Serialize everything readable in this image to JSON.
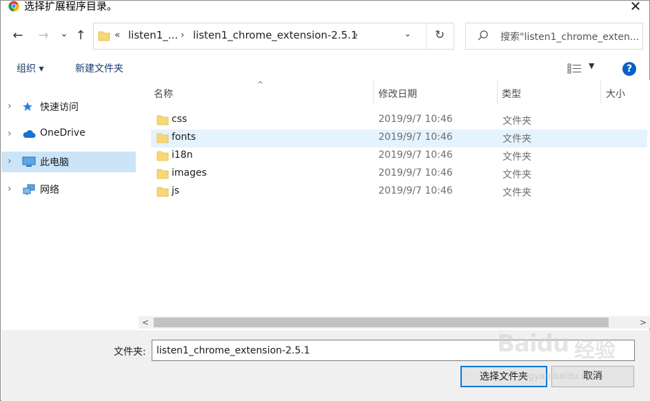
{
  "window": {
    "title": "选择扩展程序目录。",
    "close_glyph": "✕"
  },
  "nav": {
    "back_glyph": "←",
    "forward_glyph": "→",
    "recent_glyph": "⌄",
    "up_glyph": "↑"
  },
  "address": {
    "overflow_glyph": "«",
    "segment_1": "listen1_...",
    "segment_2": "listen1_chrome_extension-2.5.1",
    "separator_glyph": "›",
    "dropdown_glyph": "⌄",
    "refresh_glyph": "↻"
  },
  "search": {
    "placeholder": "搜索\"listen1_chrome_exten..."
  },
  "toolbar": {
    "organize_label": "组织 ▾",
    "new_folder_label": "新建文件夹",
    "view_dropdown_glyph": "▼",
    "help_glyph": "?"
  },
  "sidebar": {
    "items": [
      {
        "label": "快速访问",
        "icon": "star-pin-icon"
      },
      {
        "label": "OneDrive",
        "icon": "cloud-icon"
      },
      {
        "label": "此电脑",
        "icon": "computer-icon",
        "selected": true
      },
      {
        "label": "网络",
        "icon": "network-icon"
      }
    ],
    "chevron_glyph": "›"
  },
  "file_list": {
    "sort_caret": "^",
    "columns": [
      "名称",
      "修改日期",
      "类型",
      "大小"
    ],
    "rows": [
      {
        "name": "css",
        "date": "2019/9/7 10:46",
        "type": "文件夹"
      },
      {
        "name": "fonts",
        "date": "2019/9/7 10:46",
        "type": "文件夹",
        "hover": true
      },
      {
        "name": "i18n",
        "date": "2019/9/7 10:46",
        "type": "文件夹"
      },
      {
        "name": "images",
        "date": "2019/9/7 10:46",
        "type": "文件夹"
      },
      {
        "name": "js",
        "date": "2019/9/7 10:46",
        "type": "文件夹"
      }
    ]
  },
  "scrollbar": {
    "left_glyph": "<",
    "right_glyph": ">"
  },
  "bottom": {
    "folder_label": "文件夹:",
    "folder_value": "listen1_chrome_extension-2.5.1",
    "select_button": "选择文件夹",
    "cancel_button": "取消"
  },
  "watermark": {
    "logo": "Baidu",
    "cn": "经验",
    "url": "jingyan.baidu.com"
  },
  "colors": {
    "accent": "#0078d7",
    "selected_bg": "#cce4f7",
    "hover_bg": "#e5f3ff",
    "folder_yellow": "#f8d775",
    "help_blue": "#0a5fc8"
  }
}
